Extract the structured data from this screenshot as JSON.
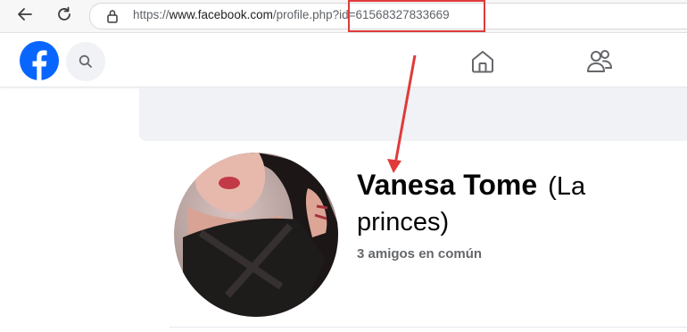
{
  "browser": {
    "url_prefix": "https://",
    "url_domain": "www.facebook.com",
    "url_path": "/profile.php?id=61568327833669",
    "icons": {
      "back": "back-arrow-icon",
      "reload": "reload-icon",
      "lock": "lock-icon"
    }
  },
  "header": {
    "icons": {
      "logo": "facebook-logo-icon",
      "search": "search-icon",
      "home": "home-icon",
      "friends": "friends-icon"
    },
    "brand_color": "#0866ff"
  },
  "profile": {
    "name": "Vanesa Tome",
    "alternate_name": "(La princes)",
    "mutual_friends": "3 amigos en común"
  },
  "annotation": {
    "color": "#e03a3a"
  }
}
